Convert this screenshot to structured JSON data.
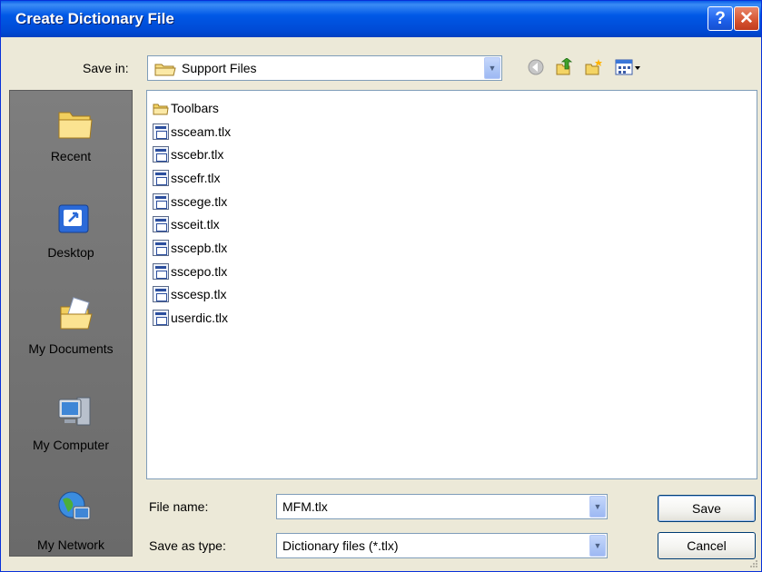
{
  "window": {
    "title": "Create Dictionary File"
  },
  "titlebar": {
    "help_glyph": "?",
    "close_glyph": "✕"
  },
  "save_in": {
    "label": "Save in:",
    "value": "Support Files"
  },
  "toolbar": {
    "icons": [
      "back-icon",
      "up-folder-icon",
      "new-folder-icon",
      "views-menu-icon"
    ]
  },
  "places": [
    {
      "label": "Recent",
      "icon": "recent-folder-icon"
    },
    {
      "label": "Desktop",
      "icon": "desktop-icon"
    },
    {
      "label": "My Documents",
      "icon": "my-documents-icon"
    },
    {
      "label": "My Computer",
      "icon": "my-computer-icon"
    },
    {
      "label": "My Network",
      "icon": "my-network-icon"
    }
  ],
  "files": [
    {
      "name": "Toolbars",
      "type": "folder"
    },
    {
      "name": "ssceam.tlx",
      "type": "file"
    },
    {
      "name": "sscebr.tlx",
      "type": "file"
    },
    {
      "name": "sscefr.tlx",
      "type": "file"
    },
    {
      "name": "sscege.tlx",
      "type": "file"
    },
    {
      "name": "ssceit.tlx",
      "type": "file"
    },
    {
      "name": "sscepb.tlx",
      "type": "file"
    },
    {
      "name": "sscepo.tlx",
      "type": "file"
    },
    {
      "name": "sscesp.tlx",
      "type": "file"
    },
    {
      "name": "userdic.tlx",
      "type": "file"
    }
  ],
  "file_name": {
    "label": "File name:",
    "value": "MFM.tlx"
  },
  "save_as_type": {
    "label": "Save as type:",
    "value": "Dictionary files (*.tlx)"
  },
  "buttons": {
    "save": "Save",
    "cancel": "Cancel"
  }
}
